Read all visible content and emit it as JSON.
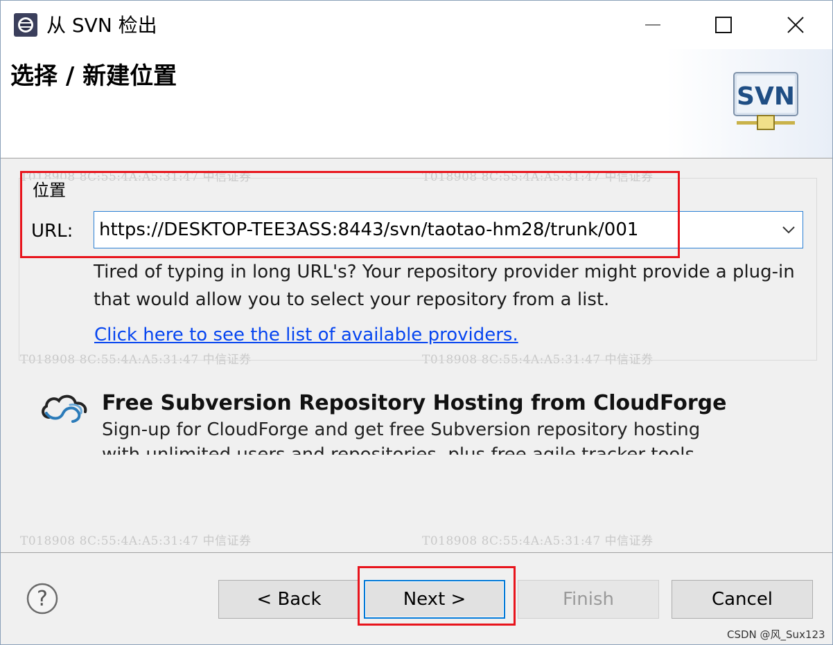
{
  "window": {
    "title": "从 SVN 检出",
    "minimize_glyph": "—",
    "maximize_glyph": "☐",
    "close_glyph": "✕"
  },
  "header": {
    "title": "选择 / 新建位置",
    "logo_text": "SVN"
  },
  "location": {
    "group_label": "位置",
    "url_label": "URL:",
    "url_value": "https://DESKTOP-TEE3ASS:8443/svn/taotao-hm28/trunk/001",
    "tip_text": "Tired of typing in long URL's?  Your repository provider might provide a plug-in that would allow you to select your repository from a list.",
    "providers_link": "Click here to see the list of available providers."
  },
  "cloudforge": {
    "title": "Free Subversion Repository Hosting from CloudForge",
    "description": "Sign-up for CloudForge and get free Subversion repository hosting with unlimited users and repositories, plus free agile tracker tools"
  },
  "footer": {
    "help_glyph": "?",
    "back_label": "< Back",
    "next_label": "Next >",
    "finish_label": "Finish",
    "cancel_label": "Cancel"
  },
  "watermark": {
    "text": "T018908   8C:55:4A:A5:31:47   中信证券"
  },
  "credit": "CSDN @风_Sux123",
  "colors": {
    "accent": "#0078d7",
    "highlight_box": "#e8141c",
    "link": "#0645f0"
  }
}
